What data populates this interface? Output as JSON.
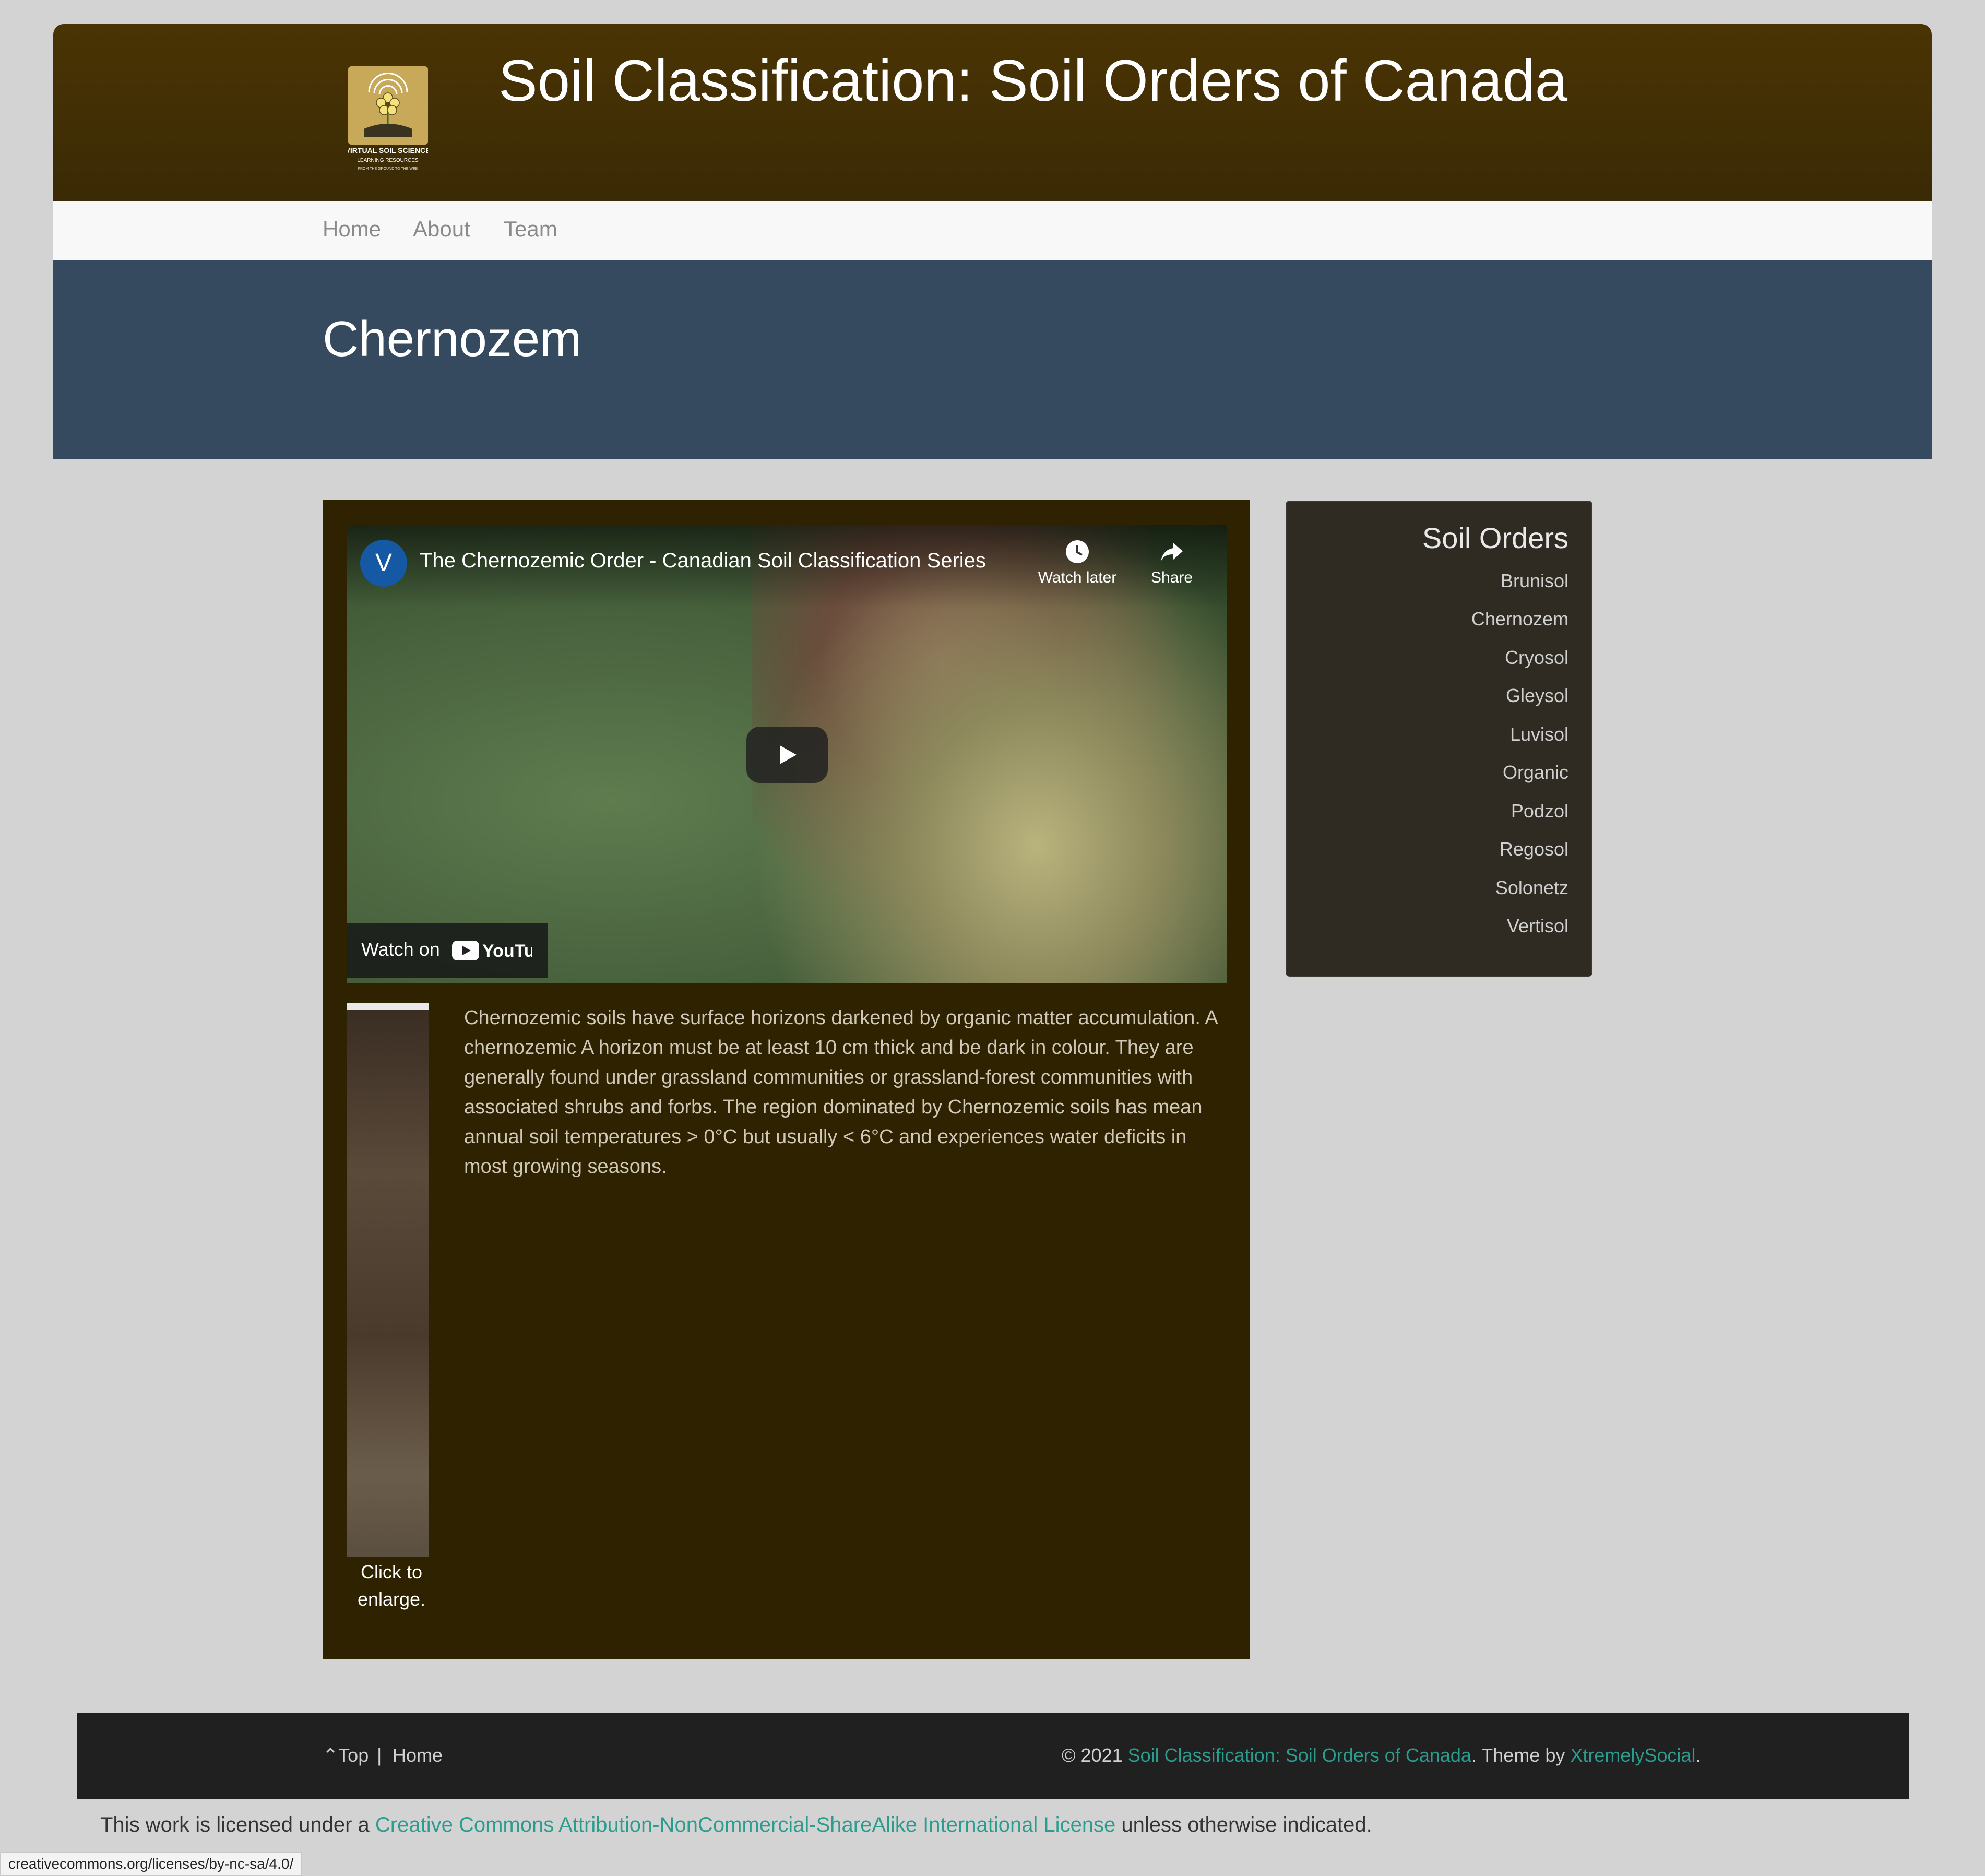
{
  "site": {
    "title": "Soil Classification: Soil Orders of Canada",
    "logo_text": [
      "VIRTUAL SOIL SCIENCE",
      "LEARNING RESOURCES",
      "FROM THE GROUND TO THE WEB"
    ]
  },
  "nav": {
    "items": [
      "Home",
      "About",
      "Team"
    ]
  },
  "page": {
    "title": "Chernozem"
  },
  "video": {
    "channel_initial": "V",
    "title": "The Chernozemic Order - Canadian Soil Classification Series",
    "watch_later": "Watch later",
    "share": "Share",
    "watch_on": "Watch on",
    "youtube": "YouTube"
  },
  "content": {
    "caption": "Click to enlarge.",
    "description": "Chernozemic soils have surface horizons darkened by organic matter accumulation. A chernozemic A horizon must be at least 10 cm thick and be dark in colour. They are generally found under grassland communities or grassland-forest communities with associated shrubs and forbs. The region dominated by Chernozemic soils has mean annual soil temperatures > 0°C but usually < 6°C and experiences water deficits in most growing seasons."
  },
  "sidebar": {
    "title": "Soil Orders",
    "items": [
      "Brunisol",
      "Chernozem",
      "Cryosol",
      "Gleysol",
      "Luvisol",
      "Organic",
      "Podzol",
      "Regosol",
      "Solonetz",
      "Vertisol"
    ]
  },
  "footer": {
    "top": "Top",
    "separator": "|",
    "home": "Home",
    "copyright_prefix": "© 2021 ",
    "site_link": "Soil Classification: Soil Orders of Canada",
    "theme_text": ". Theme by ",
    "theme_link": "XtremelySocial",
    "end": "."
  },
  "license": {
    "prefix": "This work is licensed under a ",
    "link": "Creative Commons Attribution-NonCommercial-ShareAlike International License",
    "suffix": " unless otherwise indicated."
  },
  "status_url": "creativecommons.org/licenses/by-nc-sa/4.0/",
  "colors": {
    "header": "#3f2d04",
    "nav": "#f8f8f8",
    "title_band": "#354a5e",
    "main": "#2f2200",
    "sidebar": "#2f2b22",
    "footer": "#202020",
    "link": "#2a9d8f"
  }
}
